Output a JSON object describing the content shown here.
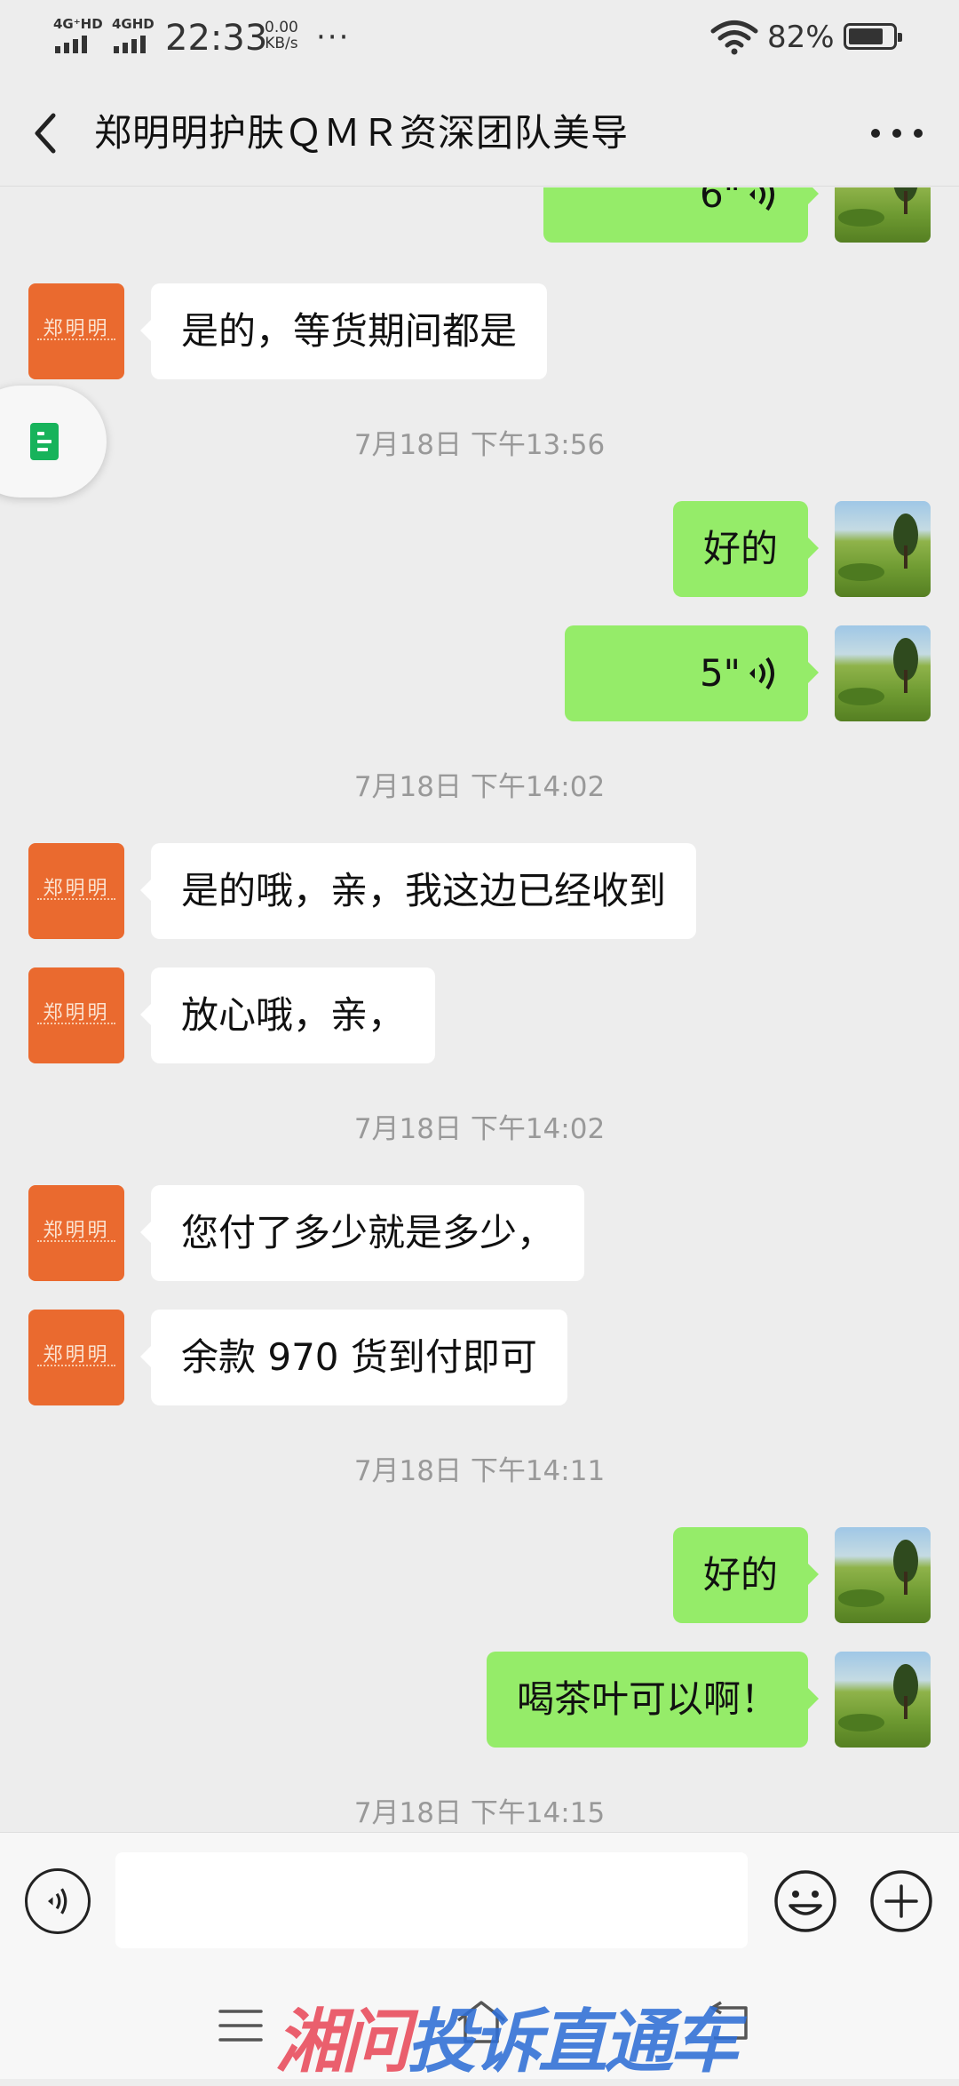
{
  "status_bar": {
    "signal1_label": "4G⁺HD",
    "signal2_label": "4GHD",
    "time": "22:33",
    "net_speed_value": "0.00",
    "net_speed_unit": "KB/s",
    "overflow": "···",
    "battery": "82%",
    "battery_level": 0.82
  },
  "header": {
    "title": "郑明明护肤ＱＭＲ资深团队美导",
    "back_icon": "chevron-left-icon",
    "more_icon": "more-dots-icon"
  },
  "contact_avatar": {
    "logo_text": "郑明明"
  },
  "messages": [
    {
      "kind": "voice",
      "side": "right",
      "duration": "6\""
    },
    {
      "kind": "text",
      "side": "left",
      "text": "是的，等货期间都是"
    },
    {
      "kind": "time",
      "text": "7月18日 下午13:56"
    },
    {
      "kind": "text",
      "side": "right",
      "text": "好的"
    },
    {
      "kind": "voice",
      "side": "right",
      "duration": "5\""
    },
    {
      "kind": "time",
      "text": "7月18日 下午14:02"
    },
    {
      "kind": "text",
      "side": "left",
      "text": "是的哦，亲，我这边已经收到"
    },
    {
      "kind": "text",
      "side": "left",
      "text": "放心哦，亲，"
    },
    {
      "kind": "time",
      "text": "7月18日 下午14:02"
    },
    {
      "kind": "text",
      "side": "left",
      "text": "您付了多少就是多少，"
    },
    {
      "kind": "text",
      "side": "left",
      "text": "余款 970 货到付即可"
    },
    {
      "kind": "time",
      "text": "7月18日 下午14:11"
    },
    {
      "kind": "text",
      "side": "right",
      "text": "好的"
    },
    {
      "kind": "text",
      "side": "right",
      "text": "喝茶叶可以啊！"
    },
    {
      "kind": "time",
      "text": "7月18日 下午14:15"
    }
  ],
  "input_bar": {
    "voice_icon": "voice-input-icon",
    "text_value": "",
    "emoji_icon": "emoji-icon",
    "plus_icon": "plus-icon"
  },
  "nav_bar": {
    "menu_icon": "menu-icon",
    "home_icon": "home-icon",
    "back_icon": "back-icon"
  },
  "watermark": {
    "part1": "湘问",
    "part2": "投诉直通车"
  },
  "colors": {
    "background": "#ededed",
    "own_bubble": "#95ec69",
    "other_bubble": "#ffffff",
    "brand_avatar": "#ea6a2f",
    "floating_doc": "#17b35b"
  }
}
